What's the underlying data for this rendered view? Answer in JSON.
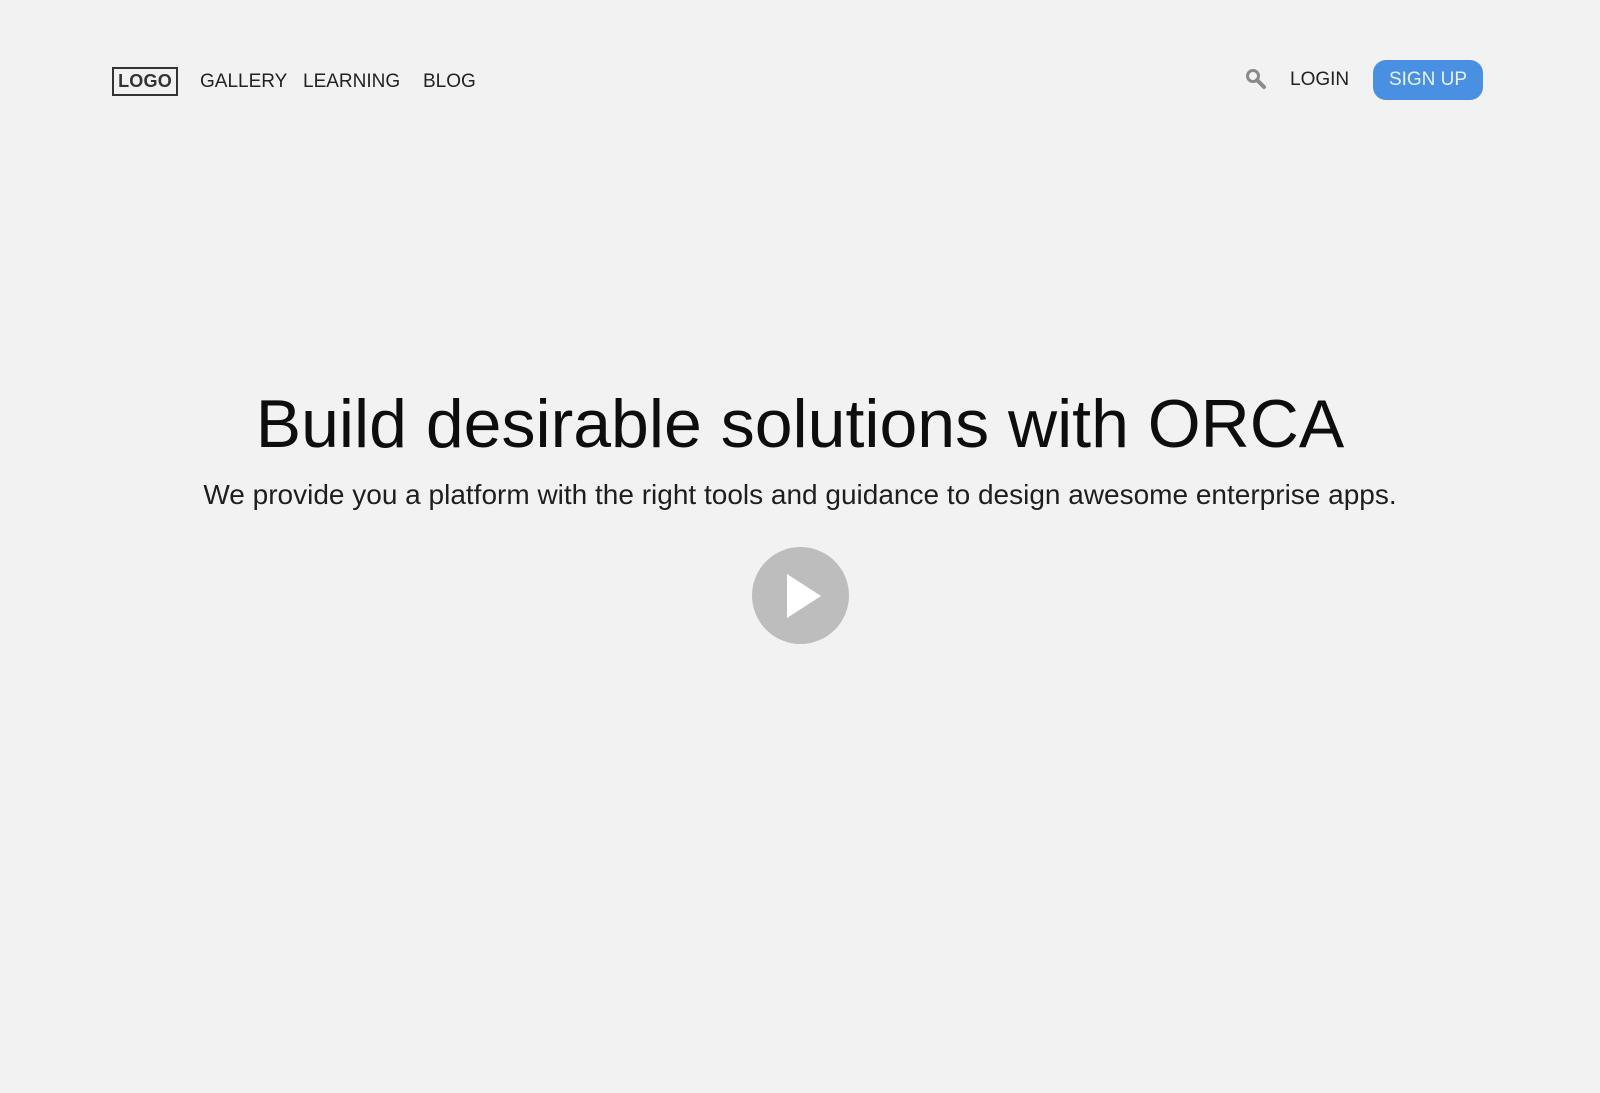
{
  "header": {
    "logo_text": "LOGO",
    "nav": [
      {
        "label": "GALLERY"
      },
      {
        "label": "LEARNING"
      },
      {
        "label": "BLOG"
      }
    ],
    "search_icon": "search-icon",
    "login_label": "LOGIN",
    "signup_label": "SIGN UP"
  },
  "hero": {
    "title": "Build desirable solutions with ORCA",
    "subtitle": "We provide you a platform with the right tools and guidance to design awesome enterprise apps.",
    "play_icon": "play-icon"
  },
  "colors": {
    "background": "#f2f2f2",
    "accent": "#4a90e2",
    "play_button": "#bdbdbd"
  }
}
